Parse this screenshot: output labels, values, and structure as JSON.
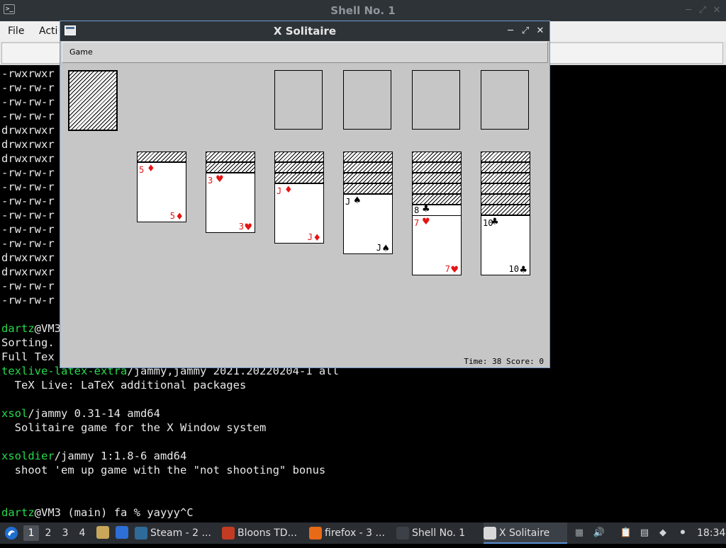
{
  "terminal": {
    "title": "Shell No. 1",
    "title_icon": ">_",
    "menu": [
      "File",
      "Acti"
    ],
    "lines": [
      {
        "a": "",
        "b": "-rwxrwxr"
      },
      {
        "a": "",
        "b": "-rw-rw-r"
      },
      {
        "a": "",
        "b": "-rw-rw-r"
      },
      {
        "a": "",
        "b": "-rw-rw-r"
      },
      {
        "a": "",
        "b": "drwxrwxr"
      },
      {
        "a": "",
        "b": "drwxrwxr"
      },
      {
        "a": "",
        "b": "drwxrwxr"
      },
      {
        "a": "",
        "b": "-rw-rw-r"
      },
      {
        "a": "",
        "b": "-rw-rw-r"
      },
      {
        "a": "",
        "b": "-rw-rw-r"
      },
      {
        "a": "",
        "b": "-rw-rw-r"
      },
      {
        "a": "",
        "b": "-rw-rw-r"
      },
      {
        "a": "",
        "b": "-rw-rw-r"
      },
      {
        "a": "",
        "b": "drwxrwxr"
      },
      {
        "a": "",
        "b": "drwxrwxr"
      },
      {
        "a": "",
        "b": "-rw-rw-r"
      },
      {
        "a": "",
        "b": "-rw-rw-r"
      },
      {
        "a": "",
        "b": ""
      },
      {
        "a": "dartz",
        "b": "@VM3"
      },
      {
        "a": "",
        "b": "Sorting."
      },
      {
        "a": "",
        "b": "Full Tex"
      },
      {
        "a": "texlive-latex-extra",
        "b": "/jammy,jammy 2021.20220204-1 all"
      },
      {
        "a": "",
        "b": "  TeX Live: LaTeX additional packages"
      },
      {
        "a": "",
        "b": ""
      },
      {
        "a": "xsol",
        "b": "/jammy 0.31-14 amd64"
      },
      {
        "a": "",
        "b": "  Solitaire game for the X Window system"
      },
      {
        "a": "",
        "b": ""
      },
      {
        "a": "xsoldier",
        "b": "/jammy 1:1.8-6 amd64"
      },
      {
        "a": "",
        "b": "  shoot 'em up game with the \"not shooting\" bonus"
      },
      {
        "a": "",
        "b": ""
      },
      {
        "a": "",
        "b": ""
      },
      {
        "a": "dartz",
        "b": "@VM3 (main) fa % yayyy^C"
      }
    ]
  },
  "solitaire": {
    "title": "X Solitaire",
    "menu_game": "Game",
    "status": "Time: 38 Score: 0",
    "tableau": [
      {
        "facedown": 1,
        "rank": "5",
        "suit": "♦",
        "color": "red"
      },
      {
        "facedown": 2,
        "rank": "3",
        "suit": "♥",
        "color": "red"
      },
      {
        "facedown": 3,
        "rank": "J",
        "suit": "♦",
        "color": "red"
      },
      {
        "facedown": 4,
        "rank": "J",
        "suit": "♠",
        "color": "black"
      },
      {
        "facedown": 5,
        "faceup_covered": [
          {
            "rank": "8",
            "suit": "♣",
            "color": "black"
          }
        ],
        "rank": "7",
        "suit": "♥",
        "color": "red"
      },
      {
        "facedown": 6,
        "rank": "10",
        "suit": "♣",
        "color": "black"
      }
    ]
  },
  "taskbar": {
    "workspaces": [
      "1",
      "2",
      "3",
      "4"
    ],
    "active_workspace": "1",
    "tasks": [
      {
        "label": "Steam - 2 ...",
        "icon": "steam-icon",
        "color": "#2f6b9a"
      },
      {
        "label": "Bloons TD...",
        "icon": "bloons-icon",
        "color": "#c23b22"
      },
      {
        "label": "firefox - 3 ...",
        "icon": "firefox-icon",
        "color": "#e86a17"
      },
      {
        "label": "Shell No. 1",
        "icon": "terminal-icon",
        "color": "#3c4147"
      },
      {
        "label": "X Solitaire",
        "icon": "window-icon",
        "color": "#d8d8d8"
      }
    ],
    "clock": "18:34"
  }
}
